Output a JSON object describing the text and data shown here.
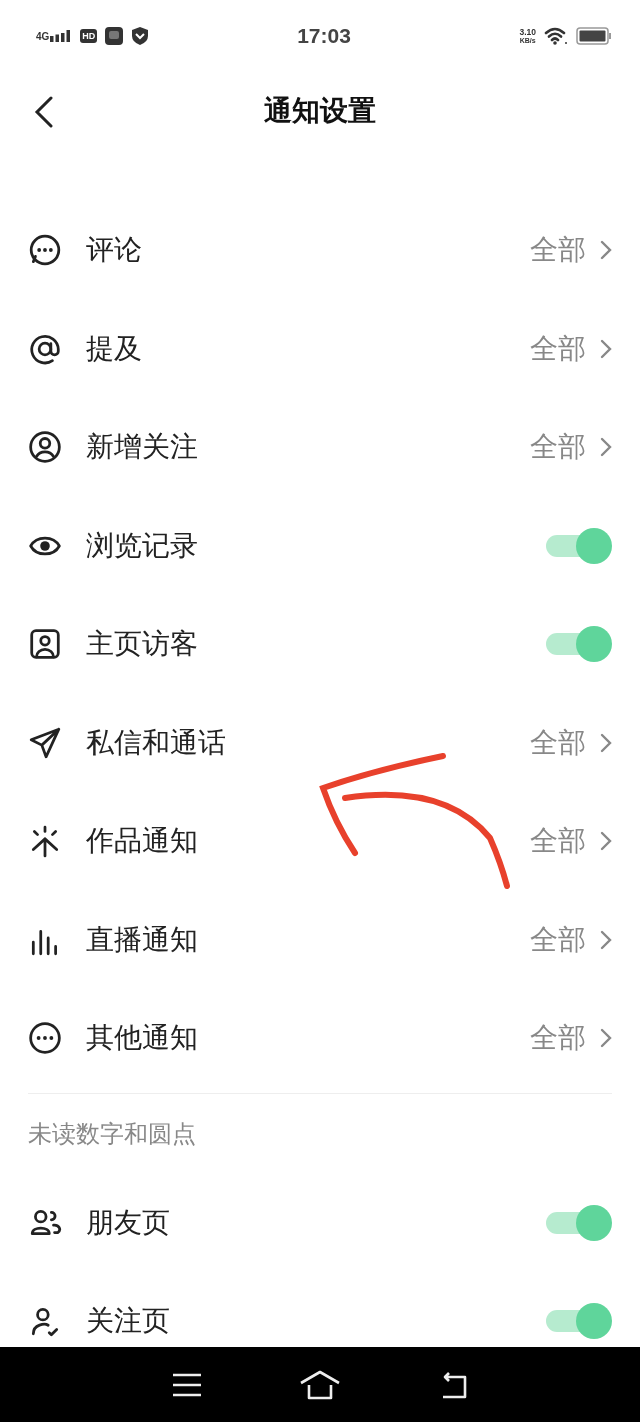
{
  "status_bar": {
    "network": "4G",
    "hd": "HD",
    "time": "17:03",
    "speed": "3.10",
    "speed_unit": "KB/s"
  },
  "header": {
    "title": "通知设置"
  },
  "rows": [
    {
      "kind": "link",
      "label": "评论",
      "value": "全部"
    },
    {
      "kind": "link",
      "label": "提及",
      "value": "全部"
    },
    {
      "kind": "link",
      "label": "新增关注",
      "value": "全部"
    },
    {
      "kind": "toggle",
      "label": "浏览记录",
      "on": true
    },
    {
      "kind": "toggle",
      "label": "主页访客",
      "on": true
    },
    {
      "kind": "link",
      "label": "私信和通话",
      "value": "全部"
    },
    {
      "kind": "link",
      "label": "作品通知",
      "value": "全部"
    },
    {
      "kind": "link",
      "label": "直播通知",
      "value": "全部"
    },
    {
      "kind": "link",
      "label": "其他通知",
      "value": "全部"
    }
  ],
  "section": {
    "title": "未读数字和圆点",
    "rows": [
      {
        "kind": "toggle",
        "label": "朋友页",
        "on": true
      },
      {
        "kind": "toggle",
        "label": "关注页",
        "on": true
      }
    ]
  },
  "annotation": {
    "kind": "arrow"
  }
}
